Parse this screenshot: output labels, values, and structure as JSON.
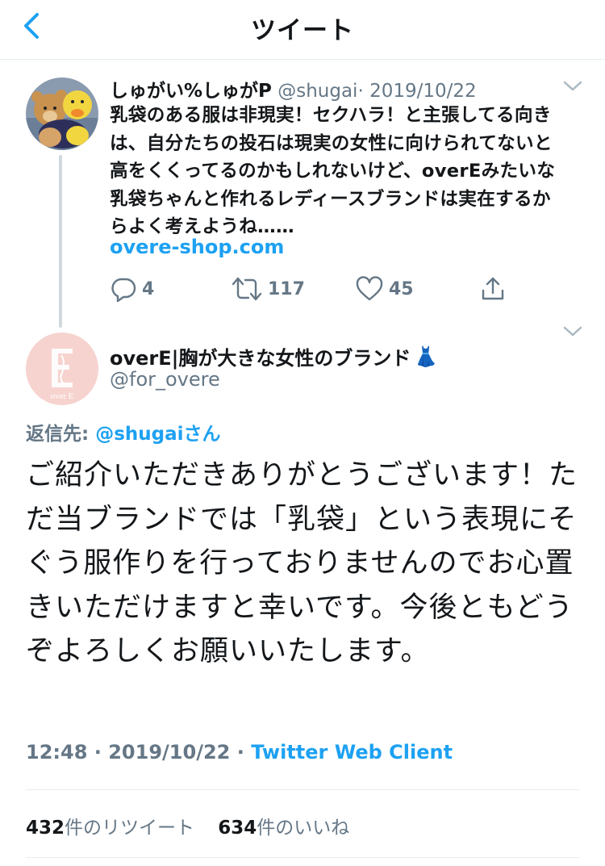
{
  "header": {
    "title": "ツイート",
    "back_icon": "chevron-left-icon"
  },
  "parent_tweet": {
    "name": "しゅがい%しゅがP",
    "handle": "@shugai",
    "separator": "·",
    "date": "2019/10/22",
    "text": "乳袋のある服は非現実！セクハラ！と主張してる向きは、自分たちの投石は現実の女性に向けられてないと高をくくってるのかもしれないけど、overEみたいな乳袋ちゃんと作れるレディースブランドは実在するからよく考えようね……",
    "link": "overe-shop.com",
    "replies": "4",
    "retweets": "117",
    "likes": "45"
  },
  "main_tweet": {
    "name": "overE|胸が大きな女性のブランド",
    "name_emoji": "👗",
    "handle": "@for_overe",
    "avatar_text": "over E",
    "reply_to_label": "返信先: ",
    "reply_to_mention": "@shugaiさん",
    "text": "ご紹介いただきありがとうございます！ただ当ブランドでは「乳袋」という表現にそぐう服作りを行っておりませんのでお心置きいただけますと幸いです。今後ともどうぞよろしくお願いいたします。",
    "time": "12:48",
    "date": "2019/10/22",
    "separator": " · ",
    "client": "Twitter Web Client",
    "retweet_count": "432",
    "retweet_label": "件のリツイート",
    "like_count": "634",
    "like_label": "件のいいね"
  },
  "colors": {
    "accent": "#1da1f2",
    "secondary_text": "#657786",
    "avatar2_bg": "#f6d3cf"
  }
}
